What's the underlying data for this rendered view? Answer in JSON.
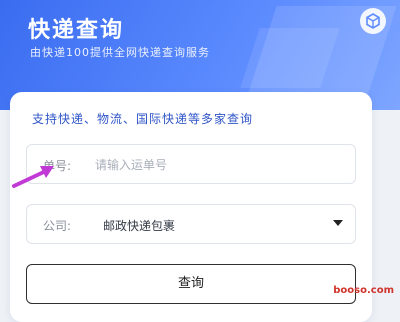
{
  "header": {
    "title": "快递查询",
    "subtitle": "由快递100提供全网快递查询服务",
    "icon": "cube-icon"
  },
  "card": {
    "support_text": "支持快递、物流、国际快递等多家查询",
    "tracking": {
      "label": "单号:",
      "placeholder": "请输入运单号"
    },
    "company": {
      "label": "公司:",
      "value": "邮政快递包裹"
    },
    "query_button": "查询"
  },
  "watermark": "booso.com",
  "colors": {
    "header_gradient_start": "#3a6cf0",
    "header_gradient_end": "#7ea6ff",
    "accent_text": "#2f55c8",
    "arrow": "#c23ad6"
  }
}
